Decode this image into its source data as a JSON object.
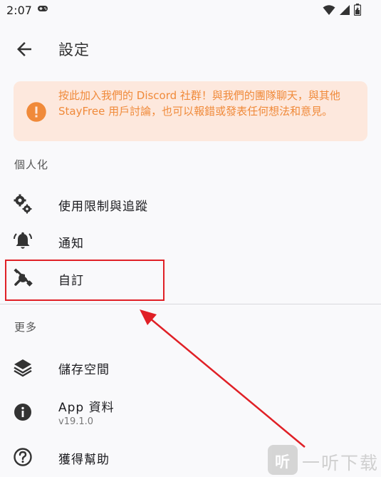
{
  "status_bar": {
    "time": "2:07"
  },
  "app_bar": {
    "title": "設定"
  },
  "banner": {
    "text": "按此加入我們的 Discord 社群！與我們的團隊聊天，與其他 StayFree 用戶討論，也可以報錯或發表任何想法和意見。"
  },
  "sections": [
    {
      "header": "個人化",
      "items": [
        {
          "label": "使用限制與追蹤",
          "icon": "gears-icon"
        },
        {
          "label": "通知",
          "icon": "bell-icon"
        },
        {
          "label": "自訂",
          "icon": "tools-icon"
        }
      ]
    },
    {
      "header": "更多",
      "items": [
        {
          "label": "儲存空間",
          "icon": "layers-icon"
        },
        {
          "label": "App 資料",
          "subtitle": "v19.1.0",
          "icon": "info-icon"
        },
        {
          "label": "獲得幫助",
          "icon": "help-icon"
        }
      ]
    }
  ],
  "watermark": {
    "logo_char": "听",
    "text": "一听下载"
  },
  "colors": {
    "accent": "#f08a3a",
    "banner_bg": "#fde8dd",
    "annotation": "#e02026"
  }
}
